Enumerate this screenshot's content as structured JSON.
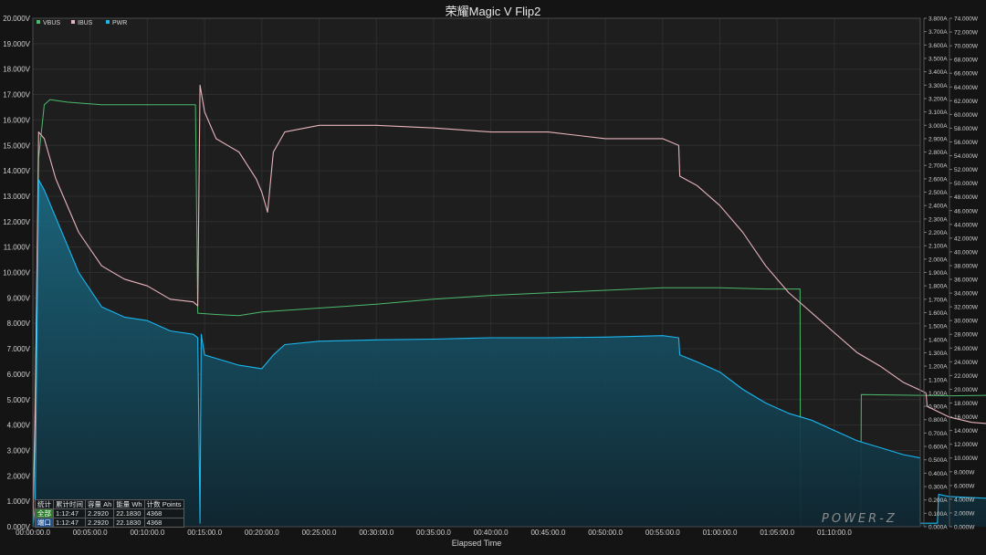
{
  "chart_data": {
    "type": "line",
    "title": "荣耀Magic V Flip2",
    "xlabel": "Elapsed Time",
    "x_ticks": [
      "00:00:00.0",
      "00:05:00.0",
      "00:10:00.0",
      "00:15:00.0",
      "00:20:00.0",
      "00:25:00.0",
      "00:30:00.0",
      "00:35:00.0",
      "00:40:00.0",
      "00:45:00.0",
      "00:50:00.0",
      "00:55:00.0",
      "01:00:00.0",
      "01:05:00.0",
      "01:10:00.0"
    ],
    "xlim_min": [
      0,
      77.5
    ],
    "y_left": {
      "unit": "V",
      "lim": [
        0,
        20
      ],
      "ticks": [
        "0.000V",
        "1.000V",
        "2.000V",
        "3.000V",
        "4.000V",
        "5.000V",
        "6.000V",
        "7.000V",
        "8.000V",
        "9.000V",
        "10.000V",
        "11.000V",
        "12.000V",
        "13.000V",
        "14.000V",
        "15.000V",
        "16.000V",
        "17.000V",
        "18.000V",
        "19.000V",
        "20.000V"
      ]
    },
    "y_right1": {
      "unit": "A",
      "lim": [
        0,
        3.8
      ],
      "ticks": [
        "0.000A",
        "0.100A",
        "0.200A",
        "0.300A",
        "0.400A",
        "0.500A",
        "0.600A",
        "0.700A",
        "0.800A",
        "0.900A",
        "1.000A",
        "1.100A",
        "1.200A",
        "1.300A",
        "1.400A",
        "1.500A",
        "1.600A",
        "1.700A",
        "1.800A",
        "1.900A",
        "2.000A",
        "2.100A",
        "2.200A",
        "2.300A",
        "2.400A",
        "2.500A",
        "2.600A",
        "2.700A",
        "2.800A",
        "2.900A",
        "3.000A",
        "3.100A",
        "3.200A",
        "3.300A",
        "3.400A",
        "3.500A",
        "3.600A",
        "3.700A",
        "3.800A"
      ]
    },
    "y_right2": {
      "unit": "W",
      "lim": [
        0,
        74
      ],
      "ticks": [
        "0.000W",
        "2.000W",
        "4.000W",
        "6.000W",
        "8.000W",
        "10.000W",
        "12.000W",
        "14.000W",
        "16.000W",
        "18.000W",
        "20.000W",
        "22.000W",
        "24.000W",
        "26.000W",
        "28.000W",
        "30.000W",
        "32.000W",
        "34.000W",
        "36.000W",
        "38.000W",
        "40.000W",
        "42.000W",
        "44.000W",
        "46.000W",
        "48.000W",
        "50.000W",
        "52.000W",
        "54.000W",
        "56.000W",
        "58.000W",
        "60.000W",
        "62.000W",
        "64.000W",
        "66.000W",
        "68.000W",
        "70.000W",
        "72.000W",
        "74.000W"
      ]
    },
    "grid": true,
    "legend_position": "top-left",
    "series": [
      {
        "name": "VBUS",
        "axis": "V",
        "color": "#4cba6c",
        "points": [
          [
            0,
            0
          ],
          [
            0.2,
            5
          ],
          [
            0.5,
            14.5
          ],
          [
            1,
            16.6
          ],
          [
            1.5,
            16.8
          ],
          [
            3,
            16.7
          ],
          [
            6,
            16.6
          ],
          [
            14.2,
            16.6
          ],
          [
            14.4,
            8.4
          ],
          [
            16,
            8.35
          ],
          [
            18,
            8.3
          ],
          [
            20,
            8.45
          ],
          [
            25,
            8.6
          ],
          [
            30,
            8.75
          ],
          [
            35,
            8.95
          ],
          [
            40,
            9.1
          ],
          [
            45,
            9.2
          ],
          [
            50,
            9.3
          ],
          [
            55,
            9.4
          ],
          [
            60,
            9.4
          ],
          [
            64,
            9.35
          ],
          [
            67,
            9.35
          ],
          [
            67.05,
            0
          ],
          [
            72.3,
            0
          ],
          [
            72.35,
            5.2
          ],
          [
            80,
            5.15
          ],
          [
            90,
            5.2
          ],
          [
            104,
            5.25
          ]
        ]
      },
      {
        "name": "IBUS",
        "axis": "A",
        "color": "#e8b4bc",
        "points": [
          [
            0,
            0
          ],
          [
            0.2,
            0.8
          ],
          [
            0.5,
            2.95
          ],
          [
            1,
            2.9
          ],
          [
            2,
            2.6
          ],
          [
            4,
            2.2
          ],
          [
            6,
            1.95
          ],
          [
            8,
            1.85
          ],
          [
            10,
            1.8
          ],
          [
            12,
            1.7
          ],
          [
            14,
            1.68
          ],
          [
            14.4,
            1.65
          ],
          [
            14.6,
            3.3
          ],
          [
            15,
            3.1
          ],
          [
            16,
            2.9
          ],
          [
            18,
            2.8
          ],
          [
            19.5,
            2.6
          ],
          [
            20,
            2.5
          ],
          [
            20.5,
            2.35
          ],
          [
            21,
            2.8
          ],
          [
            22,
            2.95
          ],
          [
            25,
            3.0
          ],
          [
            30,
            3.0
          ],
          [
            35,
            2.98
          ],
          [
            40,
            2.95
          ],
          [
            45,
            2.95
          ],
          [
            50,
            2.9
          ],
          [
            55,
            2.9
          ],
          [
            56.4,
            2.85
          ],
          [
            56.5,
            2.62
          ],
          [
            58,
            2.55
          ],
          [
            60,
            2.4
          ],
          [
            62,
            2.2
          ],
          [
            64,
            1.95
          ],
          [
            66,
            1.75
          ],
          [
            68,
            1.6
          ],
          [
            70,
            1.45
          ],
          [
            72,
            1.3
          ],
          [
            74,
            1.2
          ],
          [
            76,
            1.08
          ],
          [
            78,
            1.0
          ],
          [
            78.1,
            0.9
          ],
          [
            80,
            0.82
          ],
          [
            82,
            0.78
          ],
          [
            85,
            0.76
          ],
          [
            90,
            0.7
          ],
          [
            95,
            0.65
          ],
          [
            100,
            0.56
          ],
          [
            102,
            0.53
          ],
          [
            104,
            0.5
          ]
        ]
      },
      {
        "name": "PWR",
        "axis": "W",
        "color": "#1ab6ee",
        "points": [
          [
            0,
            0
          ],
          [
            0.2,
            3
          ],
          [
            0.5,
            50.5
          ],
          [
            1,
            49
          ],
          [
            2,
            45
          ],
          [
            4,
            37
          ],
          [
            6,
            32
          ],
          [
            8,
            30.5
          ],
          [
            10,
            30
          ],
          [
            12,
            28.5
          ],
          [
            14,
            28
          ],
          [
            14.4,
            27.5
          ],
          [
            14.6,
            0.5
          ],
          [
            14.7,
            28
          ],
          [
            15,
            25
          ],
          [
            16,
            24.5
          ],
          [
            18,
            23.5
          ],
          [
            20,
            23
          ],
          [
            21,
            25
          ],
          [
            22,
            26.5
          ],
          [
            25,
            27
          ],
          [
            30,
            27.2
          ],
          [
            35,
            27.3
          ],
          [
            40,
            27.5
          ],
          [
            45,
            27.5
          ],
          [
            50,
            27.6
          ],
          [
            55,
            27.8
          ],
          [
            56.4,
            27.5
          ],
          [
            56.5,
            25
          ],
          [
            58,
            24
          ],
          [
            60,
            22.5
          ],
          [
            62,
            20
          ],
          [
            64,
            18
          ],
          [
            66,
            16.5
          ],
          [
            68,
            15.5
          ],
          [
            70,
            14
          ],
          [
            72,
            12.5
          ],
          [
            74,
            11.5
          ],
          [
            76,
            10.5
          ],
          [
            77.5,
            10
          ],
          [
            77.5,
            0.5
          ],
          [
            79,
            0.5
          ],
          [
            79.1,
            4.7
          ],
          [
            80,
            4.4
          ],
          [
            85,
            4.0
          ],
          [
            90,
            3.8
          ],
          [
            95,
            3.6
          ],
          [
            100,
            3.1
          ],
          [
            104,
            2.9
          ]
        ]
      }
    ]
  },
  "stats_table": {
    "header": [
      "统计",
      "累计时间",
      "容量 Ah",
      "能量 Wh",
      "计数 Points"
    ],
    "rows": [
      [
        "全部",
        "1:12:47",
        "2.2920",
        "22.1830",
        "4368"
      ],
      [
        "端口",
        "1:12:47",
        "2.2920",
        "22.1830",
        "4368"
      ]
    ]
  },
  "logo_text": "POWER-Z"
}
